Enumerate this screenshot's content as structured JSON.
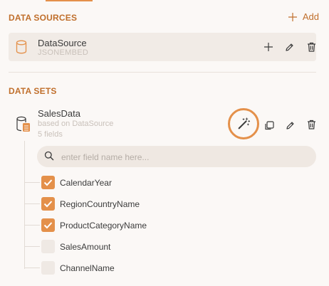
{
  "data_sources": {
    "title": "DATA SOURCES",
    "add_label": "Add",
    "items": [
      {
        "name": "DataSource",
        "type": "JSONEMBED"
      }
    ]
  },
  "data_sets": {
    "title": "DATA SETS",
    "items": [
      {
        "name": "SalesData",
        "source_text": "based on DataSource",
        "fields_count_text": "5 fields"
      }
    ]
  },
  "field_search": {
    "placeholder": "enter field name here..."
  },
  "fields": [
    {
      "label": "CalendarYear",
      "checked": true
    },
    {
      "label": "RegionCountryName",
      "checked": true
    },
    {
      "label": "ProductCategoryName",
      "checked": true
    },
    {
      "label": "SalesAmount",
      "checked": false
    },
    {
      "label": "ChannelName",
      "checked": false
    }
  ],
  "colors": {
    "accent": "#e4904a",
    "section_title": "#c06f2c",
    "muted_text": "#c9c1ba",
    "background": "#fbf8f6",
    "card": "#f1ebe6"
  }
}
